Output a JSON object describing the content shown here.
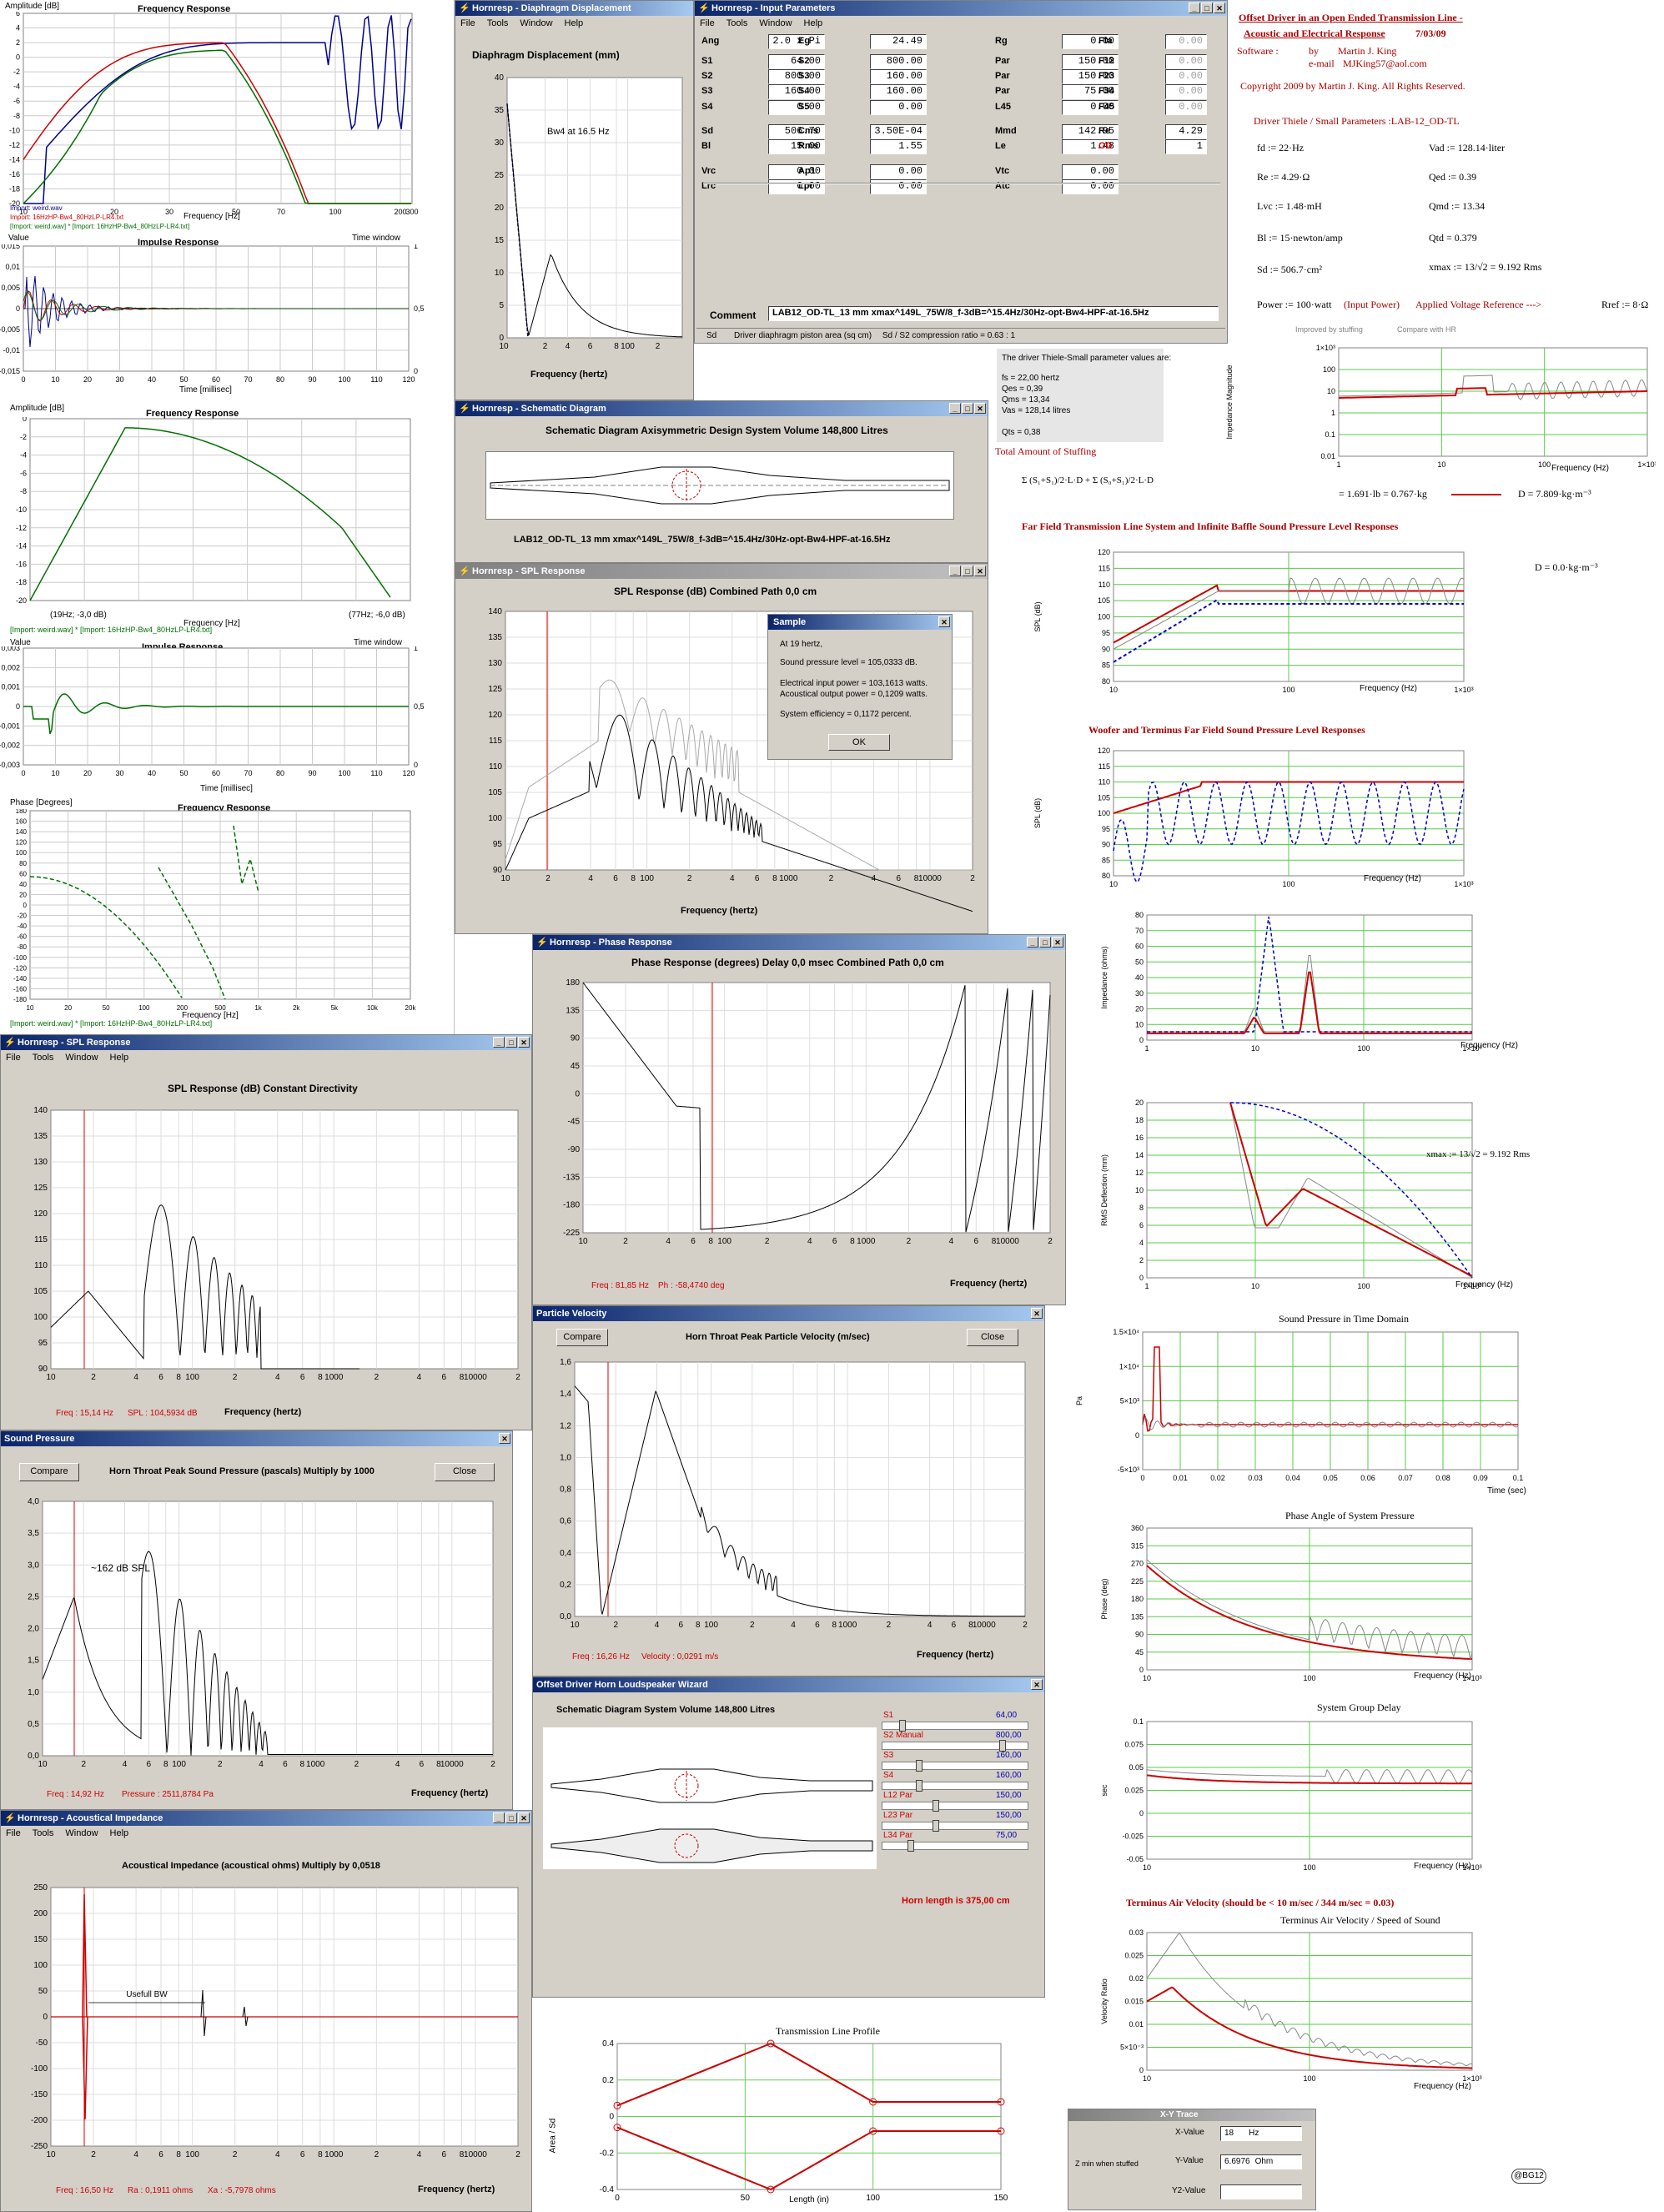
{
  "left": {
    "fr_amp": {
      "ylabel": "Amplitude [dB]",
      "title": "Frequency Response",
      "yticks": [
        "6",
        "4",
        "2",
        "0",
        "-2",
        "-4",
        "-6",
        "-8",
        "-10",
        "-12",
        "-14",
        "-16",
        "-18",
        "-20"
      ],
      "xticks": [
        "10",
        "20",
        "30",
        "50",
        "70",
        "100",
        "200",
        "300"
      ],
      "xlabel": "Frequency [Hz]",
      "legend": [
        "Import: weird.wav",
        "Import: 16HzHP-Bw4_80HzLP-LR4.txt",
        "[Import: weird.wav] * [Import: 16HzHP-Bw4_80HzLP-LR4.txt]"
      ]
    },
    "imp1": {
      "ylabel": "Value",
      "title": "Impulse Response",
      "timewindow": "Time window",
      "yticks": [
        "0,015",
        "0,01",
        "0,005",
        "0",
        "-0,005",
        "-0,01",
        "-0,015"
      ],
      "rticks": [
        "1",
        "0,5",
        "0"
      ],
      "xticks": [
        "0",
        "10",
        "20",
        "30",
        "40",
        "50",
        "60",
        "70",
        "80",
        "90",
        "100",
        "110",
        "120"
      ],
      "xlabel": "Time [millisec]"
    },
    "fr2": {
      "ylabel": "Amplitude [dB]",
      "title": "Frequency Response",
      "yticks": [
        "0",
        "-2",
        "-4",
        "-6",
        "-8",
        "-10",
        "-12",
        "-14",
        "-16",
        "-18",
        "-20"
      ],
      "xlabel": "Frequency [Hz]",
      "marker_left": "(19Hz; -3,0 dB)",
      "marker_right": "(77Hz; -6,0 dB)",
      "legend": "[Import: weird.wav] * [Import: 16HzHP-Bw4_80HzLP-LR4.txt]"
    },
    "imp2": {
      "ylabel": "Value",
      "title": "Impulse Response",
      "timewindow": "Time window",
      "yticks": [
        "0,003",
        "0,002",
        "0,001",
        "0",
        "-0,001",
        "-0,002",
        "-0,003"
      ],
      "rticks": [
        "1",
        "0,5",
        "0"
      ],
      "xticks": [
        "0",
        "10",
        "20",
        "30",
        "40",
        "50",
        "60",
        "70",
        "80",
        "90",
        "100",
        "110",
        "120"
      ],
      "xlabel": "Time [millisec]"
    },
    "phase": {
      "ylabel": "Phase [Degrees]",
      "title": "Frequency Response",
      "yticks": [
        "180",
        "160",
        "140",
        "120",
        "100",
        "80",
        "60",
        "40",
        "20",
        "0",
        "-20",
        "-40",
        "-60",
        "-80",
        "-100",
        "-120",
        "-140",
        "-160",
        "-180"
      ],
      "xticks": [
        "10",
        "20",
        "50",
        "100",
        "200",
        "500",
        "1k",
        "2k",
        "5k",
        "10k",
        "20k"
      ],
      "xlabel": "Frequency [Hz]",
      "legend": "[Import: weird.wav] * [Import: 16HzHP-Bw4_80HzLP-LR4.txt]"
    }
  },
  "menus": [
    "File",
    "Tools",
    "Window",
    "Help"
  ],
  "diaphragm": {
    "title": "Hornresp - Diaphragm Displacement",
    "chart_title": "Diaphragm Displacement (mm)",
    "annotation": "Bw4 at 16.5 Hz",
    "yticks": [
      "40",
      "35",
      "30",
      "25",
      "20",
      "15",
      "10",
      "5",
      "0"
    ],
    "xticks": [
      "10",
      "2",
      "4",
      "6",
      "8",
      "100",
      "2"
    ],
    "xlabel": "Frequency (hertz)"
  },
  "input": {
    "title": "Hornresp - Input Parameters",
    "rows": [
      [
        [
          "Ang",
          "2.0 x Pi"
        ],
        [
          "Eg",
          "24.49"
        ],
        [
          "Rg",
          "0.00"
        ],
        [
          "Fta",
          "0.00"
        ]
      ],
      [
        [
          "S1",
          "64.00"
        ],
        [
          "S2",
          "800.00"
        ],
        [
          "Par",
          "150.00"
        ],
        [
          "F12",
          "0.00"
        ]
      ],
      [
        [
          "S2",
          "800.00"
        ],
        [
          "S3",
          "160.00"
        ],
        [
          "Par",
          "150.00"
        ],
        [
          "F23",
          "0.00"
        ]
      ],
      [
        [
          "S3",
          "160.00"
        ],
        [
          "S4",
          "160.00"
        ],
        [
          "Par",
          "75.00"
        ],
        [
          "F34",
          "0.00"
        ]
      ],
      [
        [
          "S4",
          "0.00"
        ],
        [
          "S5",
          "0.00"
        ],
        [
          "L45",
          "0.00"
        ],
        [
          "F45",
          "0.00"
        ]
      ],
      [
        [
          "Sd",
          "506.70"
        ],
        [
          "Cms",
          "3.50E-04"
        ],
        [
          "Mmd",
          "142.95"
        ],
        [
          "Re",
          "4.29"
        ]
      ],
      [
        [
          "Bl",
          "15.00"
        ],
        [
          "Rms",
          "1.55"
        ],
        [
          "Le",
          "1.48"
        ],
        [
          "OD",
          "1"
        ]
      ],
      [
        [
          "Vrc",
          "0.00"
        ],
        [
          "Ap1",
          "0.00"
        ],
        [
          "Vtc",
          "0.00"
        ]
      ],
      [
        [
          "Lrc",
          "0.00"
        ],
        [
          "Lpt",
          "0.00"
        ],
        [
          "Atc",
          "0.00"
        ]
      ]
    ],
    "comment_label": "Comment",
    "comment": "LAB12_OD-TL_13 mm xmax^149L_75W/8_f-3dB=^15.4Hz/30Hz-opt-Bw4-HPF-at-16.5Hz",
    "status_a": "Sd",
    "status_b": "Driver diaphragm piston area  (sq cm)",
    "status_c": "Sd / S2 compression ratio = 0.63 : 1"
  },
  "schematic": {
    "title": "Hornresp - Schematic Diagram",
    "heading": "Schematic Diagram    Axisymmetric Design    System Volume 148,800 Litres",
    "caption": "LAB12_OD-TL_13 mm xmax^149L_75W/8_f-3dB=^15.4Hz/30Hz-opt-Bw4-HPF-at-16.5Hz"
  },
  "spl_top": {
    "title": "Hornresp - SPL Response",
    "chart_title": "SPL Response (dB)    Combined    Path 0,0 cm",
    "yticks": [
      "140",
      "135",
      "130",
      "125",
      "120",
      "115",
      "110",
      "105",
      "100",
      "95",
      "90"
    ],
    "xticks": [
      "10",
      "2",
      "4",
      "6",
      "8",
      "100",
      "2",
      "4",
      "6",
      "8",
      "1000",
      "2",
      "4",
      "6",
      "8",
      "10000",
      "2"
    ],
    "xlabel": "Frequency (hertz)",
    "sample": {
      "title": "Sample",
      "l1": "At 19 hertz,",
      "l2": "Sound pressure level = 105,0333 dB.",
      "l3": "Electrical input power = 103,1613 watts.",
      "l4": "Acoustical output power = 0,1209 watts.",
      "l5": "System efficiency = 0,1172 percent.",
      "ok": "OK"
    }
  },
  "phase": {
    "title": "Hornresp - Phase Response",
    "chart_title": "Phase Response (degrees)    Delay 0,0 msec    Combined    Path 0,0 cm",
    "yticks": [
      "180",
      "135",
      "90",
      "45",
      "0",
      "-45",
      "-90",
      "-135",
      "-180",
      "-225"
    ],
    "xticks": [
      "10",
      "2",
      "4",
      "6",
      "8",
      "100",
      "2",
      "4",
      "6",
      "8",
      "1000",
      "2",
      "4",
      "6",
      "8",
      "10000",
      "2"
    ],
    "xlabel": "Frequency (hertz)",
    "status_a": "Freq : 81,85 Hz",
    "status_b": "Ph : -58,4740 deg"
  },
  "spl_left": {
    "title": "Hornresp - SPL Response",
    "chart_title": "SPL Response (dB)    Constant Directivity",
    "yticks": [
      "140",
      "135",
      "130",
      "125",
      "120",
      "115",
      "110",
      "105",
      "100",
      "95",
      "90"
    ],
    "xticks": [
      "10",
      "2",
      "4",
      "6",
      "8",
      "100",
      "2",
      "4",
      "6",
      "8",
      "1000",
      "2",
      "4",
      "6",
      "8",
      "10000",
      "2"
    ],
    "xlabel": "Frequency (hertz)",
    "status_a": "Freq : 15,14 Hz",
    "status_b": "SPL : 104,5934 dB"
  },
  "particle": {
    "title": "Particle Velocity",
    "compare": "Compare",
    "close": "Close",
    "chart_title": "Horn Throat Peak Particle Velocity (m/sec)",
    "yticks": [
      "1,6",
      "1,4",
      "1,2",
      "1,0",
      "0,8",
      "0,6",
      "0,4",
      "0,2",
      "0,0"
    ],
    "xticks": [
      "10",
      "2",
      "4",
      "6",
      "8",
      "100",
      "2",
      "4",
      "6",
      "8",
      "1000",
      "2",
      "4",
      "6",
      "8",
      "10000",
      "2"
    ],
    "xlabel": "Frequency (hertz)",
    "status_a": "Freq : 16,26 Hz",
    "status_b": "Velocity : 0,0291 m/s"
  },
  "pressure": {
    "title": "Sound Pressure",
    "compare": "Compare",
    "close": "Close",
    "chart_title": "Horn Throat Peak Sound Pressure (pascals)    Multiply by 1000",
    "annotation": "~162 dB SPL",
    "yticks": [
      "4,0",
      "3,5",
      "3,0",
      "2,5",
      "2,0",
      "1,5",
      "1,0",
      "0,5",
      "0,0"
    ],
    "xticks": [
      "10",
      "2",
      "4",
      "6",
      "8",
      "100",
      "2",
      "4",
      "6",
      "8",
      "1000",
      "2",
      "4",
      "6",
      "8",
      "10000",
      "2"
    ],
    "xlabel": "Frequency (hertz)",
    "status_a": "Freq : 14,92 Hz",
    "status_b": "Pressure : 2511,8784 Pa"
  },
  "wizard": {
    "title": "Offset Driver Horn Loudspeaker Wizard",
    "heading": "Schematic Diagram    System Volume 148,800 Litres",
    "params": [
      [
        "S1",
        "64,00"
      ],
      [
        "S2  Manual",
        "800,00"
      ],
      [
        "S3",
        "160,00"
      ],
      [
        "S4",
        "160,00"
      ],
      [
        "L12  Par",
        "150,00"
      ],
      [
        "L23  Par",
        "150,00"
      ],
      [
        "L34  Par",
        "75,00"
      ]
    ],
    "horn_length": "Horn length is 375,00 cm"
  },
  "acoustic": {
    "title": "Hornresp - Acoustical Impedance",
    "chart_title": "Acoustical Impedance (acoustical ohms)    Multiply by 0,0518",
    "annotation": "Usefull BW",
    "yticks": [
      "250",
      "200",
      "150",
      "100",
      "50",
      "0",
      "-50",
      "-100",
      "-150",
      "-200",
      "-250"
    ],
    "xticks": [
      "10",
      "2",
      "4",
      "6",
      "8",
      "100",
      "2",
      "4",
      "6",
      "8",
      "1000",
      "2",
      "4",
      "6",
      "8",
      "10000",
      "2"
    ],
    "xlabel": "Frequency (hertz)",
    "status_a": "Freq : 16,50 Hz",
    "status_b": "Ra : 0,1911 ohms",
    "status_c": "Xa : -5,7978 ohms"
  },
  "tl_profile": {
    "title": "Transmission Line Profile",
    "xticks": [
      "0",
      "50",
      "100",
      "150"
    ],
    "xlabel": "Length (in)",
    "yticks": [
      "0.4",
      "0.2",
      "0",
      "-0.2",
      "-0.4"
    ],
    "ylabel": "Area / Sd"
  },
  "mathcad": {
    "title1": "Offset Driver in an Open Ended Transmission Line -",
    "title2": "Acoustic and Electrical Response",
    "date": "7/03/09",
    "sw": "Software :",
    "by": "by",
    "author": "Martin J. King",
    "email_lbl": "e-mail",
    "email": "MJKing57@aol.com",
    "copyright": "Copyright 2009 by Martin J. King. All Rights Reserved.",
    "ts_title": "Driver Thiele / Small Parameters :LAB-12_OD-TL",
    "params": [
      "fd := 22·Hz",
      "Vad := 128.14·liter",
      "Re := 4.29·Ω",
      "Qed := 0.39",
      "Lvc := 1.48·mH",
      "Qmd := 13.34",
      "Bl := 15·newton/amp",
      "Qtd = 0.379",
      "Sd := 506.7·cm²",
      "xmax := 13/√2 = 9.192  Rms"
    ],
    "power": "Power := 100·watt",
    "power_note": "(Input Power)",
    "voltage": "Applied Voltage Reference --->",
    "rref": "Rref := 8·Ω",
    "improved": "Improved by stuffing",
    "compare_hr": "Compare with HR",
    "ts_box": [
      "The driver Thiele-Small parameter values are:",
      "fs = 22,00 hertz",
      "Qes = 0,39",
      "Qms = 13,34",
      "Vas = 128,14 litres",
      "Qts = 0,38"
    ],
    "stuffing": "Total Amount of Stuffing",
    "stuffing_eq": "= 1.691·lb = 0.767·kg",
    "density": "D = 7.809·kg·m⁻³",
    "density2": "D = 0.0·kg·m⁻³",
    "c1": {
      "ylabel": "Impedance Magnitude",
      "yticks": [
        "1×10³",
        "100",
        "10",
        "1",
        "0.1",
        "0.01"
      ],
      "xticks": [
        "1",
        "10",
        "100",
        "1×10³"
      ],
      "xlabel": "Frequency (Hz)"
    },
    "c2": {
      "title": "Far Field Transmission Line System and Infinite Baffle Sound Pressure Level Responses",
      "ylabel": "SPL (dB)",
      "yticks": [
        "120",
        "115",
        "110",
        "105",
        "100",
        "95",
        "90",
        "85",
        "80"
      ],
      "xticks": [
        "10",
        "100",
        "1×10³"
      ],
      "xlabel": "Frequency (Hz)"
    },
    "c3": {
      "title": "Woofer and Terminus Far Field Sound Pressure Level Responses",
      "ylabel": "SPL (dB)",
      "yticks": [
        "120",
        "115",
        "110",
        "105",
        "100",
        "95",
        "90",
        "85",
        "80"
      ],
      "xticks": [
        "10",
        "100",
        "1×10³"
      ],
      "xlabel": "Frequency (Hz)"
    },
    "c4": {
      "ylabel": "Impedance (ohms)",
      "yticks": [
        "80",
        "70",
        "60",
        "50",
        "40",
        "30",
        "20",
        "10",
        "0"
      ],
      "xticks": [
        "1",
        "10",
        "100",
        "1×10³"
      ],
      "xlabel": "Frequency (Hz)"
    },
    "c5": {
      "ylabel": "RMS Deflection (mm)",
      "yticks": [
        "20",
        "18",
        "16",
        "14",
        "12",
        "10",
        "8",
        "6",
        "4",
        "2",
        "0"
      ],
      "xticks": [
        "1",
        "10",
        "100",
        "1×10³"
      ],
      "xlabel": "Frequency (Hz)",
      "note": "xmax := 13/√2 = 9.192  Rms"
    },
    "c6": {
      "title": "Sound Pressure in Time Domain",
      "ylabel": "Pa",
      "yticks": [
        "1.5×10⁴",
        "1×10⁴",
        "5×10³",
        "0",
        "-5×10³"
      ],
      "xticks": [
        "0",
        "0.01",
        "0.02",
        "0.03",
        "0.04",
        "0.05",
        "0.06",
        "0.07",
        "0.08",
        "0.09",
        "0.1"
      ],
      "xlabel": "Time (sec)"
    },
    "c7": {
      "title": "Phase Angle of System Pressure",
      "ylabel": "Phase (deg)",
      "yticks": [
        "360",
        "315",
        "270",
        "225",
        "180",
        "135",
        "90",
        "45",
        "0"
      ],
      "xticks": [
        "10",
        "100",
        "1×10³"
      ],
      "xlabel": "Frequency (Hz)"
    },
    "c8": {
      "title": "System Group Delay",
      "ylabel": "sec",
      "yticks": [
        "0.1",
        "0.075",
        "0.05",
        "0.025",
        "0",
        "-0.025",
        "-0.05"
      ],
      "xticks": [
        "10",
        "100",
        "1×10³"
      ],
      "xlabel": "Frequency (Hz)"
    },
    "c9": {
      "title": "Terminus Air Velocity (should be < 10 m/sec / 344 m/sec = 0.03)",
      "subtitle": "Terminus Air Velocity / Speed of Sound",
      "ylabel": "Velocity Ratio",
      "yticks": [
        "0.03",
        "0.025",
        "0.02",
        "0.015",
        "0.01",
        "5×10⁻³",
        "0"
      ],
      "xticks": [
        "10",
        "100",
        "1×10³"
      ],
      "xlabel": "Frequency (Hz)"
    },
    "xy": {
      "title": "X-Y Trace",
      "note": "Z min when stuffed",
      "xlbl": "X-Value",
      "xval": "18",
      "xunit": "Hz",
      "ylbl": "Y-Value",
      "yval": "6.6976",
      "yunit": "Ohm",
      "y2lbl": "Y2-Value"
    },
    "badge": "@BG12"
  }
}
